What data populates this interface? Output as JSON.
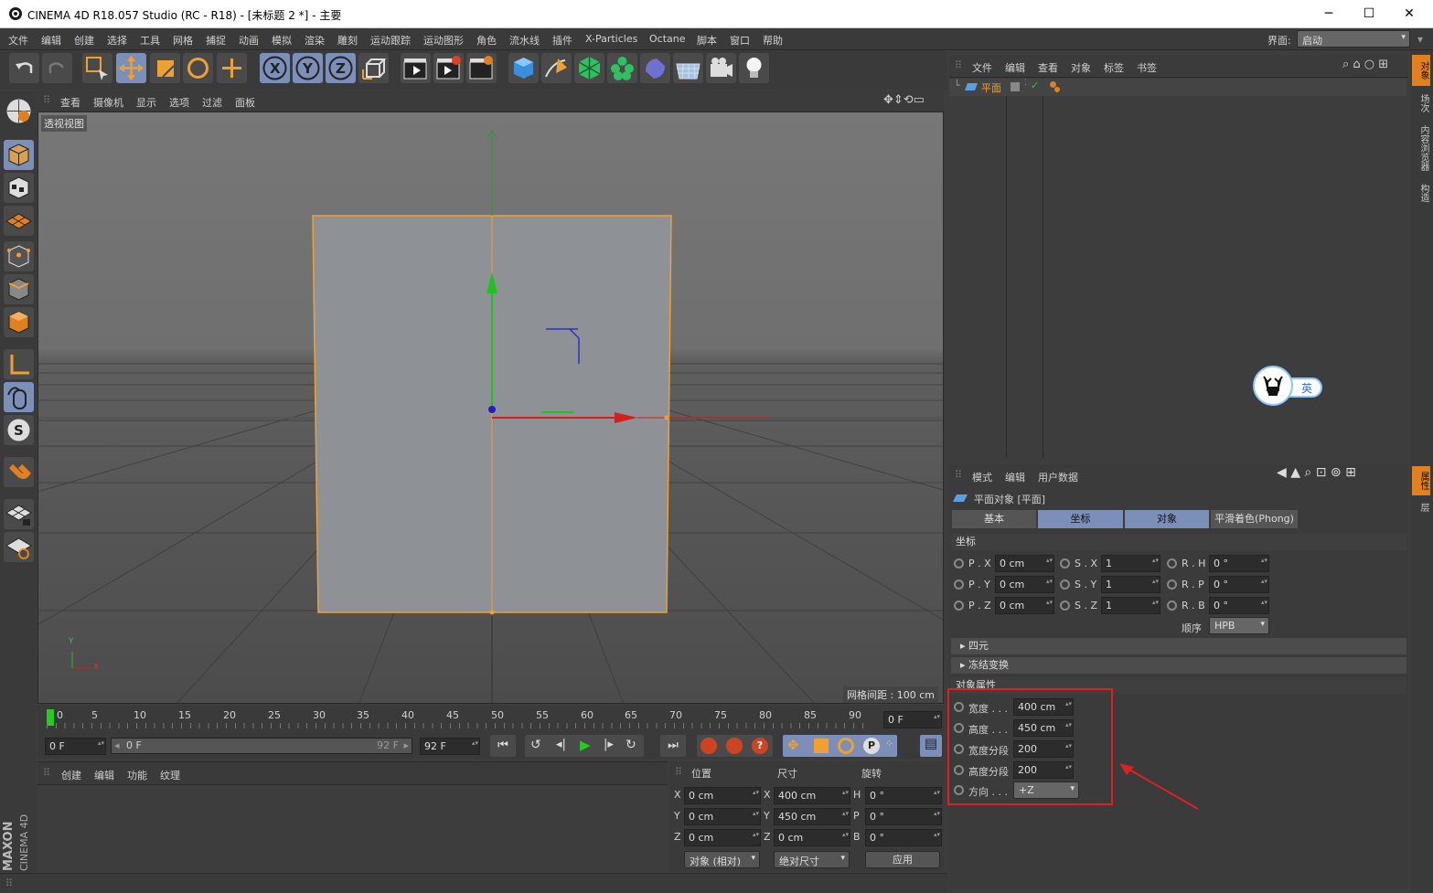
{
  "window": {
    "title": "CINEMA 4D R18.057 Studio (RC - R18) - [未标题 2 *] - 主要"
  },
  "menu": [
    "文件",
    "编辑",
    "创建",
    "选择",
    "工具",
    "网格",
    "捕捉",
    "动画",
    "模拟",
    "渲染",
    "雕刻",
    "运动跟踪",
    "运动图形",
    "角色",
    "流水线",
    "插件",
    "X-Particles",
    "Octane",
    "脚本",
    "窗口",
    "帮助"
  ],
  "layout": {
    "label": "界面:",
    "value": "启动"
  },
  "viewport": {
    "menu": [
      "查看",
      "摄像机",
      "显示",
      "选项",
      "过滤",
      "面板"
    ],
    "name": "透视视图",
    "grid_info": "网格间距 : 100 cm",
    "axis_y": "Y",
    "axis_x": "X"
  },
  "timeline": {
    "ticks": [
      "0",
      "5",
      "10",
      "15",
      "20",
      "25",
      "30",
      "35",
      "40",
      "45",
      "50",
      "55",
      "60",
      "65",
      "70",
      "75",
      "80",
      "85",
      "90"
    ],
    "current_frame": "0 F"
  },
  "transport": {
    "start": "0 F",
    "range_start": "0 F",
    "range_end": "92 F",
    "end": "92 F"
  },
  "material_manager": {
    "menu": [
      "创建",
      "编辑",
      "功能",
      "纹理"
    ]
  },
  "coord_manager": {
    "headers": [
      "位置",
      "尺寸",
      "旋转"
    ],
    "rows": [
      {
        "axis": "X",
        "pos": "0 cm",
        "size_axis": "X",
        "size": "400 cm",
        "rot_axis": "H",
        "rot": "0 °"
      },
      {
        "axis": "Y",
        "pos": "0 cm",
        "size_axis": "Y",
        "size": "450 cm",
        "rot_axis": "P",
        "rot": "0 °"
      },
      {
        "axis": "Z",
        "pos": "0 cm",
        "size_axis": "Z",
        "size": "0 cm",
        "rot_axis": "B",
        "rot": "0 °"
      }
    ],
    "mode1": "对象 (相对)",
    "mode2": "绝对尺寸",
    "apply": "应用"
  },
  "object_manager": {
    "menu": [
      "文件",
      "编辑",
      "查看",
      "对象",
      "标签",
      "书签"
    ],
    "objects": [
      {
        "name": "平面"
      }
    ]
  },
  "ime": {
    "label": "英"
  },
  "attribute_manager": {
    "menu": [
      "模式",
      "编辑",
      "用户数据"
    ],
    "object_title": "平面对象 [平面]",
    "tabs": [
      "基本",
      "坐标",
      "对象",
      "平滑着色(Phong)"
    ],
    "coord_section": "坐标",
    "coords": [
      {
        "p_label": "P . X",
        "p_val": "0 cm",
        "s_label": "S . X",
        "s_val": "1",
        "r_label": "R . H",
        "r_val": "0 °"
      },
      {
        "p_label": "P . Y",
        "p_val": "0 cm",
        "s_label": "S . Y",
        "s_val": "1",
        "r_label": "R . P",
        "r_val": "0 °"
      },
      {
        "p_label": "P . Z",
        "p_val": "0 cm",
        "s_label": "S . Z",
        "s_val": "1",
        "r_label": "R . B",
        "r_val": "0 °"
      }
    ],
    "order_label": "顺序",
    "order_value": "HPB",
    "quaternion": "四元",
    "freeze": "冻结变换",
    "object_props": "对象属性",
    "props": [
      {
        "label": "宽度 . . .",
        "value": "400 cm"
      },
      {
        "label": "高度 . . .",
        "value": "450 cm"
      },
      {
        "label": "宽度分段",
        "value": "200"
      },
      {
        "label": "高度分段",
        "value": "200"
      }
    ],
    "direction_label": "方向 . . .",
    "direction_value": "+Z"
  },
  "right_tabs": [
    "对象",
    "场次",
    "内容浏览器",
    "构造"
  ],
  "right_tabs2": [
    "属性",
    "层"
  ],
  "brand": {
    "line1": "MAXON",
    "line2": "CINEMA 4D"
  },
  "colors": {
    "accent_orange": "#f0a030",
    "highlight": "#e02020",
    "active_tab": "#7b8fb8"
  }
}
